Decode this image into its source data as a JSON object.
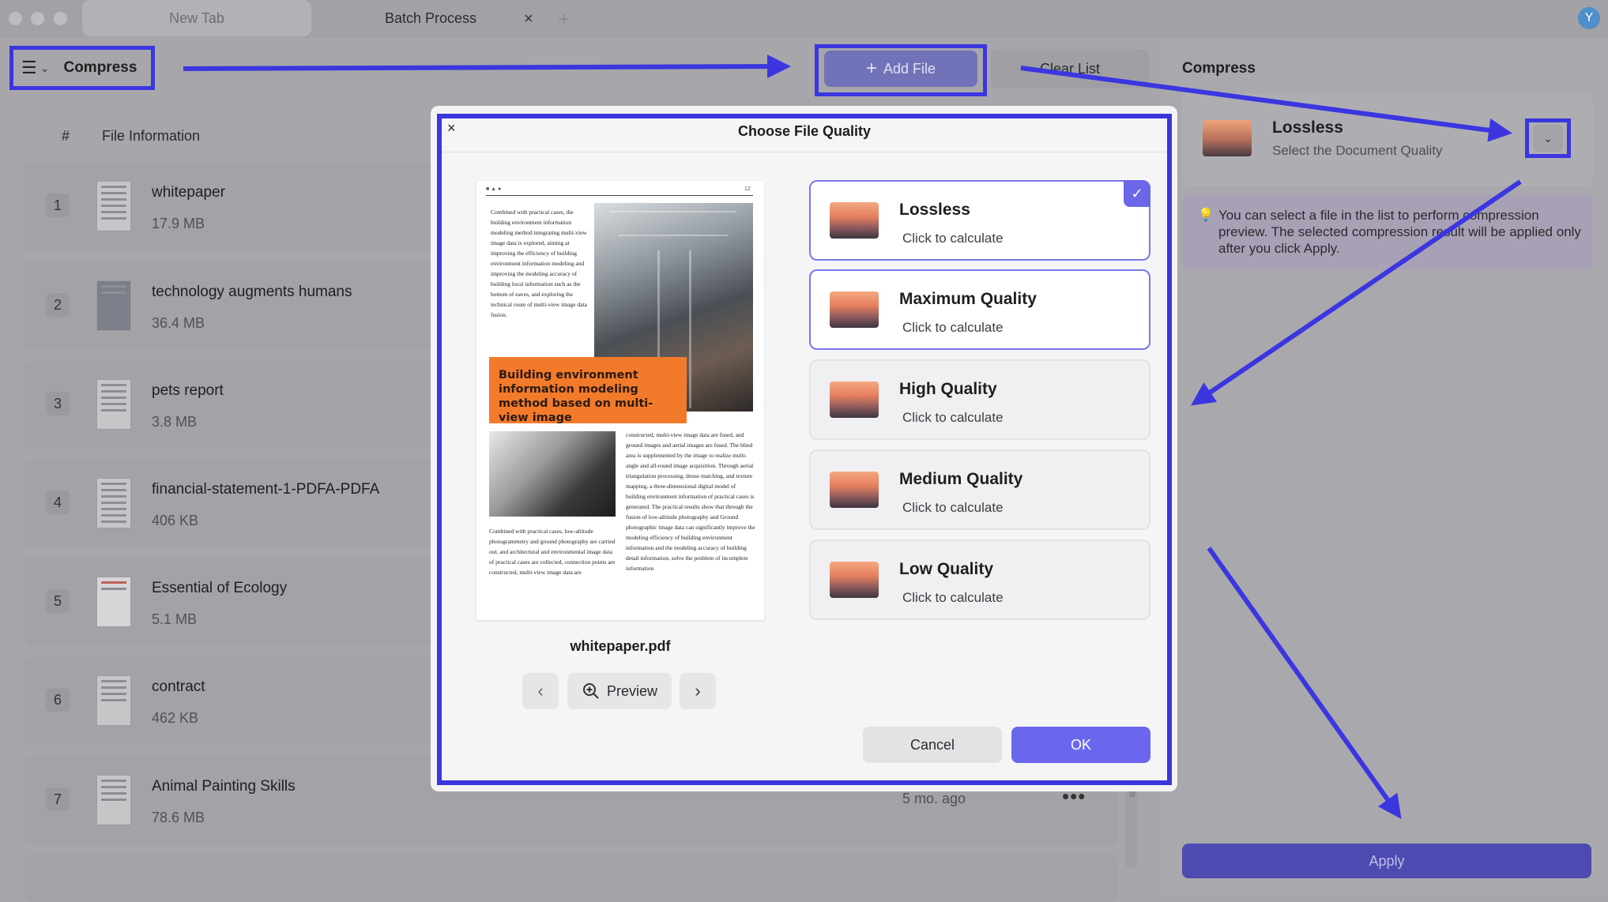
{
  "tabs": [
    {
      "label": "New Tab",
      "active": false
    },
    {
      "label": "Batch Process",
      "active": true
    }
  ],
  "tab_close_glyph": "×",
  "tab_add_glyph": "+",
  "user_avatar": "Y",
  "toolbar": {
    "mode_label": "Compress",
    "add_file_label": "Add File",
    "clear_list_label": "Clear List"
  },
  "list": {
    "col_hash": "#",
    "col_info": "File Information",
    "rows": [
      {
        "num": "1",
        "name": "whitepaper",
        "size": "17.9 MB"
      },
      {
        "num": "2",
        "name": "technology augments humans",
        "size": "36.4 MB"
      },
      {
        "num": "3",
        "name": "pets report",
        "size": "3.8 MB"
      },
      {
        "num": "4",
        "name": "financial-statement-1-PDFA-PDFA",
        "size": "406 KB"
      },
      {
        "num": "5",
        "name": "Essential of Ecology",
        "size": "5.1 MB"
      },
      {
        "num": "6",
        "name": "contract",
        "size": "462 KB"
      },
      {
        "num": "7",
        "name": "Animal Painting Skills",
        "size": "78.6 MB",
        "date": "5 mo. ago",
        "more": "•••"
      }
    ]
  },
  "right_panel": {
    "title": "Compress",
    "quality_name": "Lossless",
    "quality_sub": "Select the Document Quality",
    "dropdown_glyph": "⌄",
    "tip": "You can select a file in the list to perform compression preview. The selected compression result will be applied only after you click Apply.",
    "apply_label": "Apply"
  },
  "dialog": {
    "title": "Choose File Quality",
    "close_glyph": "×",
    "preview": {
      "header_left": "■ ▲ ●",
      "page_number": "12",
      "col1_text": "Combined with practical cases, the building environment information modeling method integrating multi-view image data is explored, aiming at improving the efficiency of building environment information modeling and improving the modeling accuracy of building local information such as the bottom of eaves, and exploring the technical route of multi-view image data fusion.",
      "orange_heading": "Building environment information modeling method based on multi-view image",
      "col2_text": "constructed, multi-view image data are fused, and ground images and aerial images are fused. The blind area is supplemented by the image to realize multi-angle and all-round image acquisition. Through aerial triangulation processing, dense matching, and texture mapping, a three-dimensional digital model of building environment information of practical cases is generated. The practical results show that through the fusion of low-altitude photography and Ground photographic image data can significantly improve the modeling efficiency of building environment information and the modeling accuracy of building detail information, solve the problem of incomplete information",
      "col3_text": "Combined with practical cases, low-altitude photogrammetry and ground photography are carried out, and architectural and environmental image data of practical cases are collected, connection points are constructed, multi-view image data are",
      "filename": "whitepaper.pdf"
    },
    "nav": {
      "prev_glyph": "‹",
      "next_glyph": "›",
      "preview_label": "Preview"
    },
    "options": [
      {
        "name": "Lossless",
        "sub": "Click to calculate",
        "selected": true
      },
      {
        "name": "Maximum Quality",
        "sub": "Click to calculate",
        "selected": false
      },
      {
        "name": "High Quality",
        "sub": "Click to calculate",
        "selected": false
      },
      {
        "name": "Medium Quality",
        "sub": "Click to calculate",
        "selected": false
      },
      {
        "name": "Low Quality",
        "sub": "Click to calculate",
        "selected": false
      }
    ],
    "check_glyph": "✓",
    "cancel_label": "Cancel",
    "ok_label": "OK"
  },
  "colors": {
    "annotation_blue": "#3b36e0",
    "accent_purple": "#6b66ee",
    "overlay_gray": "#a7a7ab"
  }
}
